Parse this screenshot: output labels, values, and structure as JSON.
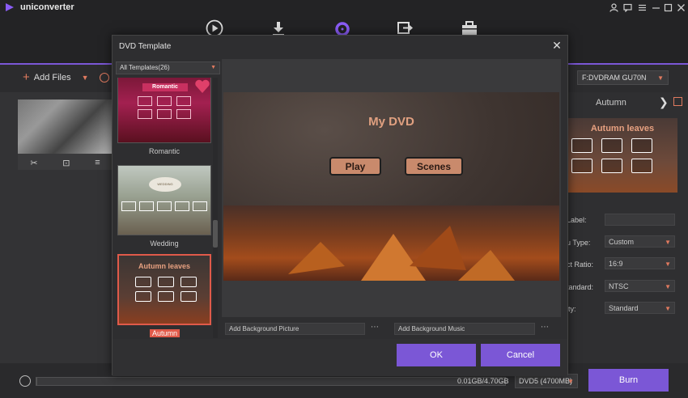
{
  "app": {
    "name": "uniconverter"
  },
  "toolbar": {
    "add_files_label": "Add Files"
  },
  "drive": {
    "selected": "F:DVDRAM GU70N"
  },
  "right_panel": {
    "title": "Autumn",
    "preview_title": "Autumn leaves",
    "fields": [
      {
        "label": "Label:",
        "value": ""
      },
      {
        "label": "u Type:",
        "value": "Custom"
      },
      {
        "label": "ct Ratio:",
        "value": "16:9"
      },
      {
        "label": "tandard:",
        "value": "NTSC"
      },
      {
        "label": "ity:",
        "value": "Standard"
      }
    ]
  },
  "bottom": {
    "progress_text": "0.01GB/4.70GB",
    "progress_fraction": 0.002,
    "dvd_option": "DVD5 (4700MB)",
    "burn_label": "Burn"
  },
  "modal": {
    "title": "DVD Template",
    "filter": "All Templates(26)",
    "templates": [
      {
        "name": "Romantic",
        "preview_title": "Romantic"
      },
      {
        "name": "Wedding",
        "preview_title": "WEDDING"
      },
      {
        "name": "Autumn",
        "preview_title": "Autumn leaves"
      }
    ],
    "preview": {
      "title": "My DVD",
      "play_label": "Play",
      "scenes_label": "Scenes"
    },
    "bg_picture_placeholder": "Add Background Picture",
    "bg_music_placeholder": "Add Background Music",
    "dots": "⋯",
    "ok_label": "OK",
    "cancel_label": "Cancel"
  },
  "colors": {
    "accent": "#7b57d6",
    "highlight": "#e05a4a",
    "orange": "#e07a5f"
  }
}
